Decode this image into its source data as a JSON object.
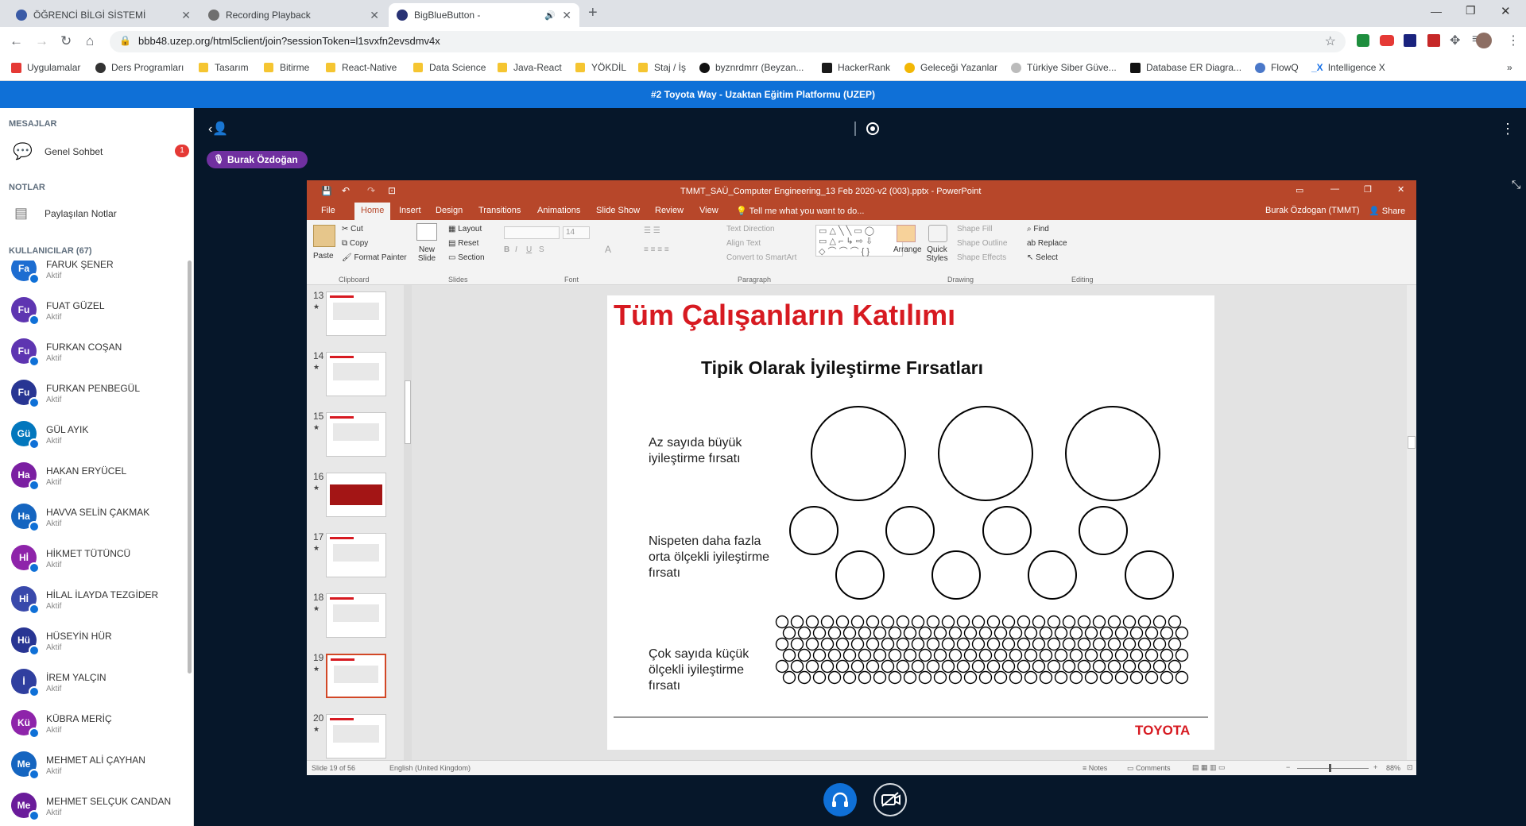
{
  "browser": {
    "tabs": [
      {
        "title": "ÖĞRENCİ BİLGİ SİSTEMİ",
        "fav": "#3a5aa6"
      },
      {
        "title": "Recording Playback",
        "fav": "#6f6f6f"
      },
      {
        "title": "BigBlueButton -",
        "fav": "#283274"
      }
    ],
    "url": "bbb48.uzep.org/html5client/join?sessionToken=l1svxfn2evsdmv4x",
    "bookmarks": [
      "Uygulamalar",
      "Ders Programları",
      "Tasarım",
      "Bitirme",
      "React-Native",
      "Data Science",
      "Java-React",
      "YÖKDİL",
      "Staj / İş",
      "byznrdmrr (Beyzan...",
      "HackerRank",
      "Geleceği Yazanlar",
      "Türkiye Siber Güve...",
      "Database ER Diagra...",
      "FlowQ",
      "Intelligence X"
    ]
  },
  "meeting": {
    "title": "#2 Toyota Way - Uzaktan Eğitim Platformu (UZEP)",
    "presenter": "Burak Özdoğan"
  },
  "sidebar": {
    "messages_header": "MESAJLAR",
    "public_chat": "Genel Sohbet",
    "unread_count": "1",
    "notes_header": "NOTLAR",
    "shared_notes": "Paylaşılan Notlar",
    "users_header": "KULLANICILAR (67)",
    "users": [
      {
        "initials": "Fa",
        "name": "FARUK ŞENER",
        "role": "Aktif",
        "color": "#1d6dd1"
      },
      {
        "initials": "Fu",
        "name": "FUAT GÜZEL",
        "role": "Aktif",
        "color": "#5e35b1"
      },
      {
        "initials": "Fu",
        "name": "FURKAN COŞAN",
        "role": "Aktif",
        "color": "#5e35b1"
      },
      {
        "initials": "Fu",
        "name": "FURKAN PENBEGÜL",
        "role": "Aktif",
        "color": "#283593"
      },
      {
        "initials": "Gü",
        "name": "GÜL AYIK",
        "role": "Aktif",
        "color": "#0277bd"
      },
      {
        "initials": "Ha",
        "name": "HAKAN ERYÜCEL",
        "role": "Aktif",
        "color": "#7b1fa2"
      },
      {
        "initials": "Ha",
        "name": "HAVVA SELİN ÇAKMAK",
        "role": "Aktif",
        "color": "#1565c0"
      },
      {
        "initials": "Hİ",
        "name": "HİKMET TÜTÜNCÜ",
        "role": "Aktif",
        "color": "#8e24aa"
      },
      {
        "initials": "Hİ",
        "name": "HİLAL İLAYDA TEZGİDER",
        "role": "Aktif",
        "color": "#3949ab"
      },
      {
        "initials": "Hü",
        "name": "HÜSEYİN HÜR",
        "role": "Aktif",
        "color": "#283593"
      },
      {
        "initials": "İ",
        "name": "İREM YALÇIN",
        "role": "Aktif",
        "color": "#303f9f"
      },
      {
        "initials": "Kü",
        "name": "KÜBRA MERİÇ",
        "role": "Aktif",
        "color": "#8e24aa"
      },
      {
        "initials": "Me",
        "name": "MEHMET ALİ ÇAYHAN",
        "role": "Aktif",
        "color": "#1565c0"
      },
      {
        "initials": "Me",
        "name": "MEHMET SELÇUK CANDAN",
        "role": "Aktif",
        "color": "#6a1b9a"
      }
    ]
  },
  "powerpoint": {
    "window_title": "TMMT_SAÜ_Computer Engineering_13 Feb 2020-v2 (003).pptx - PowerPoint",
    "user": "Burak Özdogan (TMMT)",
    "share": "Share",
    "tabs": [
      "File",
      "Home",
      "Insert",
      "Design",
      "Transitions",
      "Animations",
      "Slide Show",
      "Review",
      "View"
    ],
    "tell_me": "Tell me what you want to do...",
    "ribbon": {
      "paste": "Paste",
      "cut": "Cut",
      "copy": "Copy",
      "format_painter": "Format Painter",
      "new_slide": "New Slide",
      "layout": "Layout",
      "reset": "Reset",
      "section": "Section",
      "font_size": "14",
      "text_direction": "Text Direction",
      "align_text": "Align Text",
      "convert_smartart": "Convert to SmartArt",
      "arrange": "Arrange",
      "quick_styles": "Quick Styles",
      "shape_fill": "Shape Fill",
      "shape_outline": "Shape Outline",
      "shape_effects": "Shape Effects",
      "find": "Find",
      "replace": "Replace",
      "select": "Select",
      "groups": [
        "Clipboard",
        "Slides",
        "Font",
        "Paragraph",
        "Drawing",
        "Editing"
      ]
    },
    "thumbnails": [
      "13",
      "14",
      "15",
      "16",
      "17",
      "18",
      "19",
      "20"
    ],
    "selected_thumb": "19",
    "status": {
      "slide": "Slide 19 of 56",
      "language": "English (United Kingdom)",
      "notes": "Notes",
      "comments": "Comments",
      "zoom": "88%"
    }
  },
  "slide": {
    "title": "Tüm Çalışanların Katılımı",
    "subtitle": "Tipik Olarak İyileştirme Fırsatları",
    "row1_label": "Az sayıda büyük iyileştirme fırsatı",
    "row2_label": "Nispeten daha fazla orta ölçekli iyileştirme fırsatı",
    "row3_label": "Çok sayıda küçük ölçekli iyileştirme fırsatı",
    "logo": "TOYOTA"
  }
}
